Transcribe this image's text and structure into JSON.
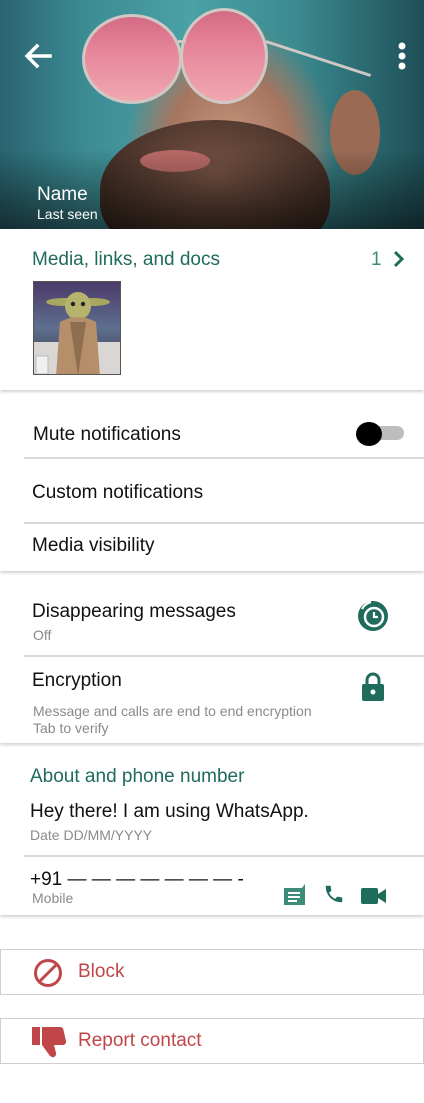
{
  "header": {
    "name": "Name",
    "last_seen": "Last seen"
  },
  "media": {
    "title": "Media, links, and docs",
    "count": "1"
  },
  "notifications": {
    "mute_label": "Mute notifications",
    "mute_enabled": false,
    "custom_label": "Custom  notifications",
    "visibility_label": "Media visibility"
  },
  "privacy": {
    "disappearing_label": "Disappearing messages",
    "disappearing_value": "Off",
    "encryption_label": "Encryption",
    "encryption_line1": "Message and calls are end to end encryption",
    "encryption_line2": "Tab to verify"
  },
  "about": {
    "title": "About and phone number",
    "status": "Hey there! I am using WhatsApp.",
    "date": "Date DD/MM/YYYY",
    "phone": "+91 — — — — — — — -",
    "phone_type": "Mobile"
  },
  "actions": {
    "block_label": "Block",
    "report_label": "Report contact"
  },
  "colors": {
    "accent": "#1f6b5c",
    "danger": "#c0464a"
  },
  "icons": [
    "back-arrow-icon",
    "more-vert-icon",
    "chevron-right-icon",
    "timer-icon",
    "lock-icon",
    "message-icon",
    "phone-icon",
    "video-icon",
    "block-icon",
    "thumbs-down-icon"
  ]
}
